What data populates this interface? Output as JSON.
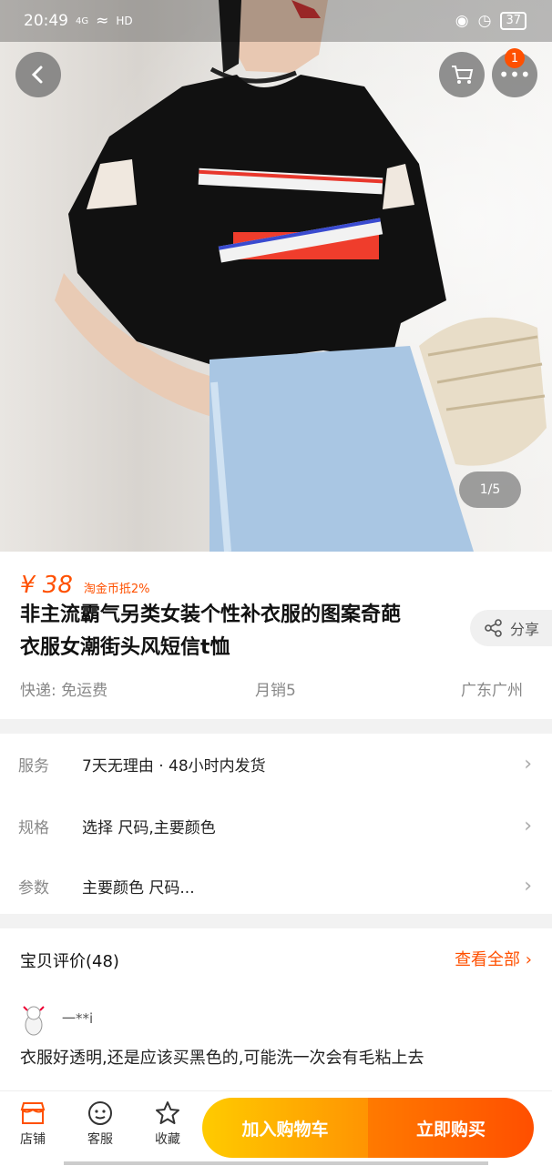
{
  "status_bar": {
    "time": "20:49",
    "network": "4G",
    "hd": "HD",
    "battery": "37"
  },
  "gallery": {
    "pager": "1/5",
    "cart_badge": "1"
  },
  "product": {
    "price": "¥ 38",
    "coin_tag": "淘金币抵2%",
    "title_line1": "非主流霸气另类女装个性补衣服的图案奇葩",
    "title_line2": "衣服女潮街头风短信t恤",
    "share_label": "分享",
    "shipping": "快递: 免运费",
    "monthly_sales": "月销5",
    "location": "广东广州"
  },
  "rows": [
    {
      "label": "服务",
      "value": "7天无理由 · 48小时内发货"
    },
    {
      "label": "规格",
      "value": "选择 尺码,主要颜色"
    },
    {
      "label": "参数",
      "value": "主要颜色 尺码..."
    }
  ],
  "reviews": {
    "heading": "宝贝评价(48)",
    "view_all": "查看全部",
    "user": "一**i",
    "text": "衣服好透明,还是应该买黑色的,可能洗一次会有毛粘上去"
  },
  "bottom_bar": {
    "shop_label": "店铺",
    "service_label": "客服",
    "favorite_label": "收藏",
    "add_cart_label": "加入购物车",
    "buy_now_label": "立即购买"
  },
  "colors": {
    "accent": "#ff5000",
    "cart_gradient_start": "#ffcb00",
    "buy_gradient_end": "#ff4f00"
  }
}
